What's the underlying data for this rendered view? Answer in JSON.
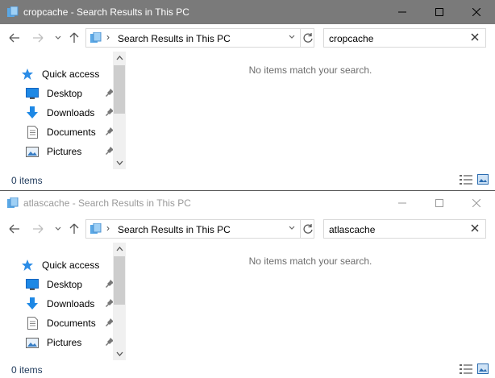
{
  "windows": [
    {
      "title": "cropcache - Search Results in This PC",
      "active": true,
      "address": "Search Results in This PC",
      "search_value": "cropcache",
      "nav_items": [
        {
          "label": "Quick access",
          "icon": "star-icon",
          "pinned": false
        },
        {
          "label": "Desktop",
          "icon": "desktop-icon",
          "pinned": true
        },
        {
          "label": "Downloads",
          "icon": "downloads-icon",
          "pinned": true
        },
        {
          "label": "Documents",
          "icon": "documents-icon",
          "pinned": true
        },
        {
          "label": "Pictures",
          "icon": "pictures-icon",
          "pinned": true
        }
      ],
      "empty_message": "No items match your search.",
      "status": "0 items"
    },
    {
      "title": "atlascache - Search Results in This PC",
      "active": false,
      "address": "Search Results in This PC",
      "search_value": "atlascache",
      "nav_items": [
        {
          "label": "Quick access",
          "icon": "star-icon",
          "pinned": false
        },
        {
          "label": "Desktop",
          "icon": "desktop-icon",
          "pinned": true
        },
        {
          "label": "Downloads",
          "icon": "downloads-icon",
          "pinned": true
        },
        {
          "label": "Documents",
          "icon": "documents-icon",
          "pinned": true
        },
        {
          "label": "Pictures",
          "icon": "pictures-icon",
          "pinned": true
        }
      ],
      "empty_message": "No items match your search.",
      "status": "0 items"
    }
  ],
  "colors": {
    "active_titlebar": "#7a7a7a",
    "inactive_title_text": "#999999",
    "accent_blue": "#1e88e5",
    "status_text": "#1e395b"
  }
}
